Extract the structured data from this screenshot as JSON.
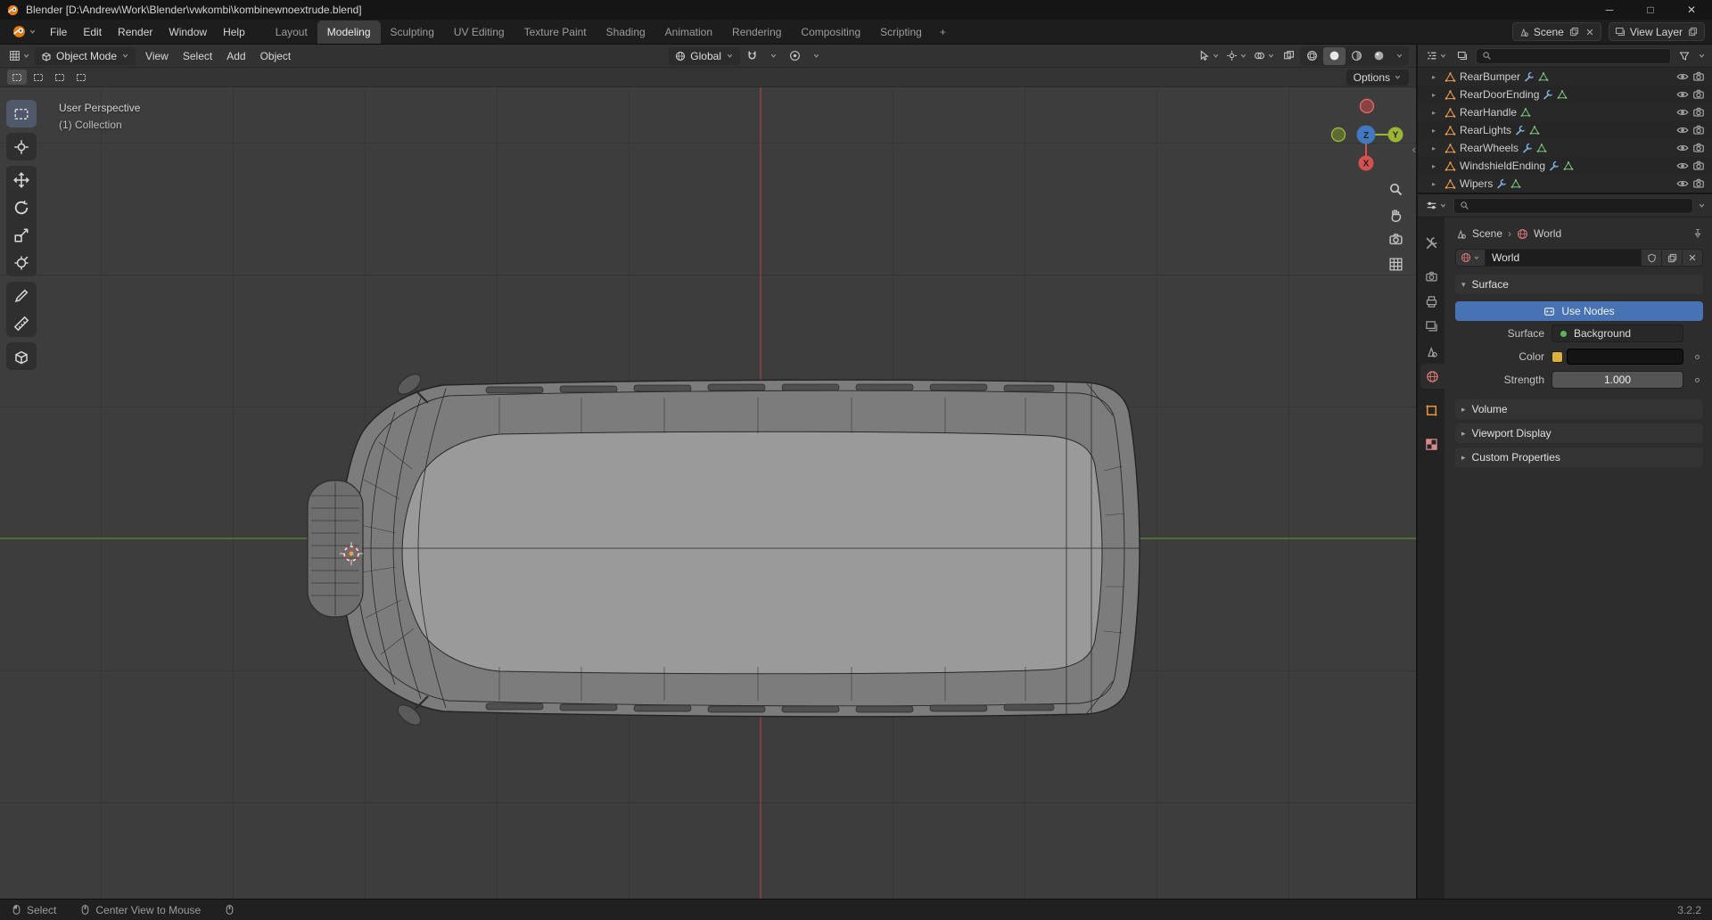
{
  "window": {
    "title": "Blender [D:\\Andrew\\Work\\Blender\\vwkombi\\kombinewnoextrude.blend]",
    "minimize": "─",
    "maximize": "□",
    "close": "✕"
  },
  "topbar": {
    "menus": [
      "File",
      "Edit",
      "Render",
      "Window",
      "Help"
    ],
    "workspaces": [
      "Layout",
      "Modeling",
      "Sculpting",
      "UV Editing",
      "Texture Paint",
      "Shading",
      "Animation",
      "Rendering",
      "Compositing",
      "Scripting"
    ],
    "active_workspace": "Modeling",
    "add_workspace": "+",
    "scene": "Scene",
    "view_layer": "View Layer"
  },
  "viewport": {
    "mode": "Object Mode",
    "menus": [
      "View",
      "Select",
      "Add",
      "Object"
    ],
    "orientation": "Global",
    "options": "Options",
    "overlay_line1": "User Perspective",
    "overlay_line2": "(1) Collection",
    "axis_labels": {
      "x": "X",
      "y": "Y",
      "z": "Z"
    }
  },
  "tools": [
    "select-box",
    "cursor",
    "move",
    "rotate",
    "scale",
    "transform",
    "annotate",
    "measure",
    "add-cube"
  ],
  "active_tool": "select-box",
  "shading_modes": [
    "wireframe",
    "solid",
    "material",
    "rendered"
  ],
  "active_shading": "solid",
  "outliner": {
    "search_value": "",
    "search_placeholder": "",
    "items": [
      {
        "name": "RearBumper",
        "modifier": true
      },
      {
        "name": "RearDoorEnding",
        "modifier": true
      },
      {
        "name": "RearHandle",
        "modifier": false
      },
      {
        "name": "RearLights",
        "modifier": true
      },
      {
        "name": "RearWheels",
        "modifier": true
      },
      {
        "name": "WindshieldEnding",
        "modifier": true
      },
      {
        "name": "Wipers",
        "modifier": true
      }
    ]
  },
  "properties": {
    "tabs": [
      "tool",
      "render",
      "output",
      "view-layer",
      "scene",
      "world",
      "object",
      "texture"
    ],
    "active_tab": "world",
    "search_value": "",
    "breadcrumb": {
      "scene": "Scene",
      "world": "World"
    },
    "world_name": "World",
    "surface": {
      "title": "Surface",
      "use_nodes": "Use Nodes",
      "surface_label": "Surface",
      "surface_value": "Background",
      "color_label": "Color",
      "strength_label": "Strength",
      "strength_value": "1.000"
    },
    "collapsed": [
      "Volume",
      "Viewport Display",
      "Custom Properties"
    ]
  },
  "status": {
    "hint1": "Select",
    "hint2": "Center View to Mouse",
    "version": "3.2.2"
  },
  "colors": {
    "accent_blue": "#4772b3",
    "mesh_orange": "#eb9b4c",
    "data_green": "#7ec47e",
    "modifier_blue": "#84b3e8",
    "axis_x": "#d6504f",
    "axis_y": "#9bb434",
    "axis_z": "#4178c0",
    "world_red": "#e07a7a"
  }
}
